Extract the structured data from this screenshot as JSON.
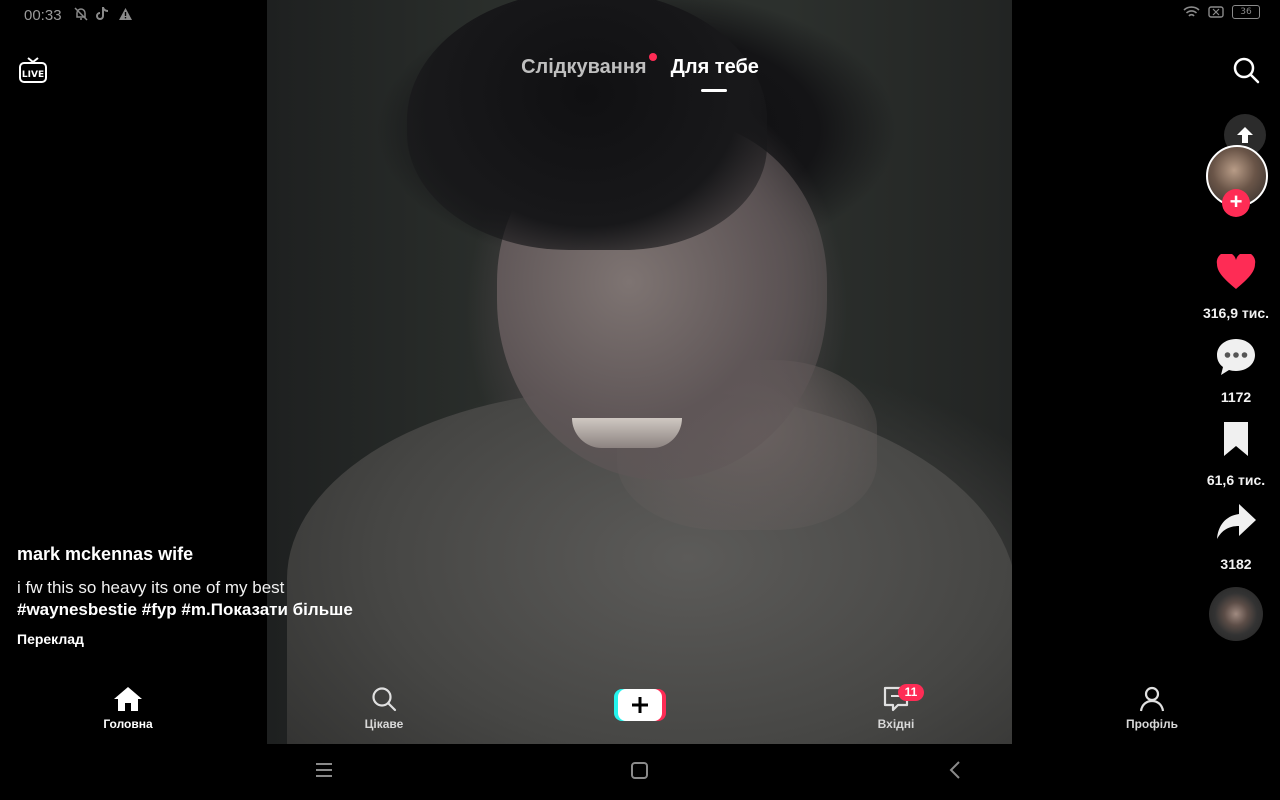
{
  "status_bar": {
    "time": "00:33",
    "battery": "36",
    "icons": [
      "mute-icon",
      "tiktok-icon",
      "warning-icon",
      "wifi-icon",
      "sim-off-icon",
      "battery-icon"
    ]
  },
  "top_nav": {
    "following_label": "Слідкування",
    "for_you_label": "Для тебе",
    "live_label": "LIVE"
  },
  "actions": {
    "likes": "316,9 тис.",
    "comments": "1172",
    "saves": "61,6 тис.",
    "shares": "3182"
  },
  "caption": {
    "author": "mark mckennas wife",
    "description": "i fw this so heavy its one of my best",
    "hashtags": "#waynesbestie #fyp #m.",
    "show_more": "Показати більше",
    "translate": "Переклад"
  },
  "bottom_nav": {
    "home": "Головна",
    "discover": "Цікаве",
    "inbox": "Вхідні",
    "inbox_badge": "11",
    "profile": "Профіль"
  },
  "colors": {
    "accent": "#fe2c55",
    "create_cyan": "#25f4ee",
    "background": "#000000"
  }
}
